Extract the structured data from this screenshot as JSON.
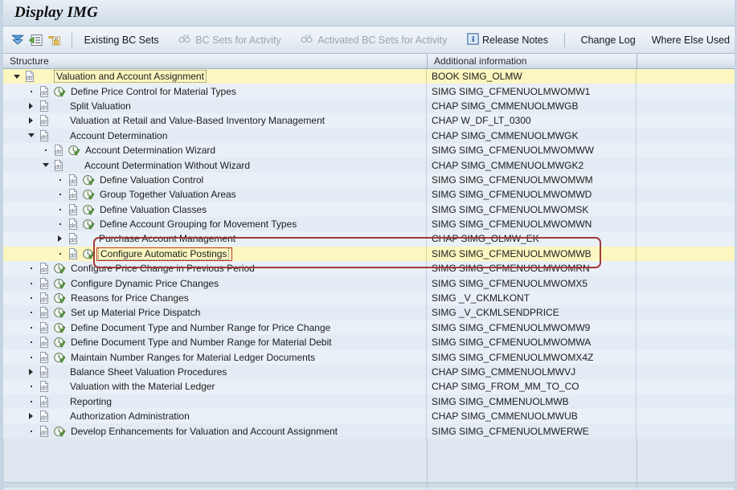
{
  "window": {
    "title": "Display IMG"
  },
  "toolbar": {
    "icons": [
      {
        "name": "collapse-all-icon",
        "glyph": "collapse-chevrons"
      },
      {
        "name": "expand-node-icon",
        "glyph": "green-list"
      },
      {
        "name": "lock-folder-icon",
        "glyph": "yellow-lock"
      }
    ],
    "buttons": [
      {
        "label": "Existing BC Sets",
        "icon": null,
        "disabled": false
      },
      {
        "label": "BC Sets for Activity",
        "icon": "bc-set-icon",
        "disabled": true
      },
      {
        "label": "Activated BC Sets for Activity",
        "icon": "bc-set-icon",
        "disabled": true
      },
      {
        "label": "Release Notes",
        "icon": "info-icon",
        "disabled": false
      },
      {
        "label": "Change Log",
        "icon": null,
        "disabled": false
      },
      {
        "label": "Where Else Used",
        "icon": null,
        "disabled": false
      }
    ]
  },
  "grid": {
    "columns": [
      {
        "key": "structure",
        "label": "Structure"
      },
      {
        "key": "additional_information",
        "label": "Additional information"
      },
      {
        "key": "spare",
        "label": ""
      }
    ],
    "rows": [
      {
        "indent": 0,
        "toggle": "down",
        "activity": false,
        "label": "Valuation and Account Assignment",
        "info": "BOOK SIMG_OLMW",
        "selected": true
      },
      {
        "indent": 1,
        "toggle": "leaf",
        "activity": true,
        "label": "Define Price Control for Material Types",
        "info": "SIMG SIMG_CFMENUOLMWOMW1",
        "selected": false
      },
      {
        "indent": 1,
        "toggle": "right",
        "activity": false,
        "label": "Split Valuation",
        "info": "CHAP SIMG_CMMENUOLMWGB",
        "selected": false
      },
      {
        "indent": 1,
        "toggle": "right",
        "activity": false,
        "label": "Valuation at Retail and Value-Based Inventory Management",
        "info": "CHAP W_DF_LT_0300",
        "selected": false
      },
      {
        "indent": 1,
        "toggle": "down",
        "activity": false,
        "label": "Account Determination",
        "info": "CHAP SIMG_CMMENUOLMWGK",
        "selected": false
      },
      {
        "indent": 2,
        "toggle": "leaf",
        "activity": true,
        "label": "Account Determination Wizard",
        "info": "SIMG SIMG_CFMENUOLMWOMWW",
        "selected": false
      },
      {
        "indent": 2,
        "toggle": "down",
        "activity": false,
        "label": "Account Determination Without Wizard",
        "info": "CHAP SIMG_CMMENUOLMWGK2",
        "selected": false
      },
      {
        "indent": 3,
        "toggle": "leaf",
        "activity": true,
        "label": "Define Valuation Control",
        "info": "SIMG SIMG_CFMENUOLMWOMWM",
        "selected": false
      },
      {
        "indent": 3,
        "toggle": "leaf",
        "activity": true,
        "label": "Group Together Valuation Areas",
        "info": "SIMG SIMG_CFMENUOLMWOMWD",
        "selected": false
      },
      {
        "indent": 3,
        "toggle": "leaf",
        "activity": true,
        "label": "Define Valuation Classes",
        "info": "SIMG SIMG_CFMENUOLMWOMSK",
        "selected": false
      },
      {
        "indent": 3,
        "toggle": "leaf",
        "activity": true,
        "label": "Define Account Grouping for Movement Types",
        "info": "SIMG SIMG_CFMENUOLMWOMWN",
        "selected": false
      },
      {
        "indent": 3,
        "toggle": "right",
        "activity": false,
        "label": "Purchase Account Management",
        "info": "CHAP SIMG_OLMW_EK",
        "selected": false
      },
      {
        "indent": 3,
        "toggle": "leaf",
        "activity": true,
        "label": "Configure Automatic Postings",
        "info": "SIMG SIMG_CFMENUOLMWOMWB",
        "selected": true
      },
      {
        "indent": 1,
        "toggle": "leaf",
        "activity": true,
        "label": "Configure Price Change in Previous Period",
        "info": "SIMG SIMG_CFMENUOLMWOMRN",
        "selected": false
      },
      {
        "indent": 1,
        "toggle": "leaf",
        "activity": true,
        "label": "Configure Dynamic Price Changes",
        "info": "SIMG SIMG_CFMENUOLMWOMX5",
        "selected": false
      },
      {
        "indent": 1,
        "toggle": "leaf",
        "activity": true,
        "label": "Reasons for Price Changes",
        "info": "SIMG _V_CKMLKONT",
        "selected": false
      },
      {
        "indent": 1,
        "toggle": "leaf",
        "activity": true,
        "label": "Set up Material Price Dispatch",
        "info": "SIMG _V_CKMLSENDPRICE",
        "selected": false
      },
      {
        "indent": 1,
        "toggle": "leaf",
        "activity": true,
        "label": "Define Document Type and Number Range for Price Change",
        "info": "SIMG SIMG_CFMENUOLMWOMW9",
        "selected": false
      },
      {
        "indent": 1,
        "toggle": "leaf",
        "activity": true,
        "label": "Define Document Type and Number Range for Material Debit",
        "info": "SIMG SIMG_CFMENUOLMWOMWA",
        "selected": false
      },
      {
        "indent": 1,
        "toggle": "leaf",
        "activity": true,
        "label": "Maintain Number Ranges for Material Ledger Documents",
        "info": "SIMG SIMG_CFMENUOLMWOMX4Z",
        "selected": false
      },
      {
        "indent": 1,
        "toggle": "right",
        "activity": false,
        "label": "Balance Sheet Valuation Procedures",
        "info": "CHAP SIMG_CMMENUOLMWVJ",
        "selected": false
      },
      {
        "indent": 1,
        "toggle": "leaf",
        "activity": false,
        "label": "Valuation with the Material Ledger",
        "info": "CHAP SIMG_FROM_MM_TO_CO",
        "selected": false
      },
      {
        "indent": 1,
        "toggle": "leaf",
        "activity": false,
        "label": "Reporting",
        "info": "SIMG SIMG_CMMENUOLMWB",
        "selected": false
      },
      {
        "indent": 1,
        "toggle": "right",
        "activity": false,
        "label": "Authorization Administration",
        "info": "CHAP SIMG_CMMENUOLMWUB",
        "selected": false
      },
      {
        "indent": 1,
        "toggle": "leaf",
        "activity": true,
        "label": "Develop Enhancements for Valuation and Account Assignment",
        "info": "SIMG SIMG_CFMENUOLMWERWE",
        "selected": false
      }
    ]
  },
  "annotation": {
    "name": "configure-automatic-postings-highlight",
    "color": "#9e3b3b",
    "target_label": "Configure Automatic Postings"
  },
  "colors": {
    "selection_yellow": "#fcf6c0",
    "grid_background": "#dfe7f0",
    "row_alt": "#eaf0f7",
    "annotation_red": "#9e3b3b",
    "activity_green": "#4e9b3e"
  }
}
